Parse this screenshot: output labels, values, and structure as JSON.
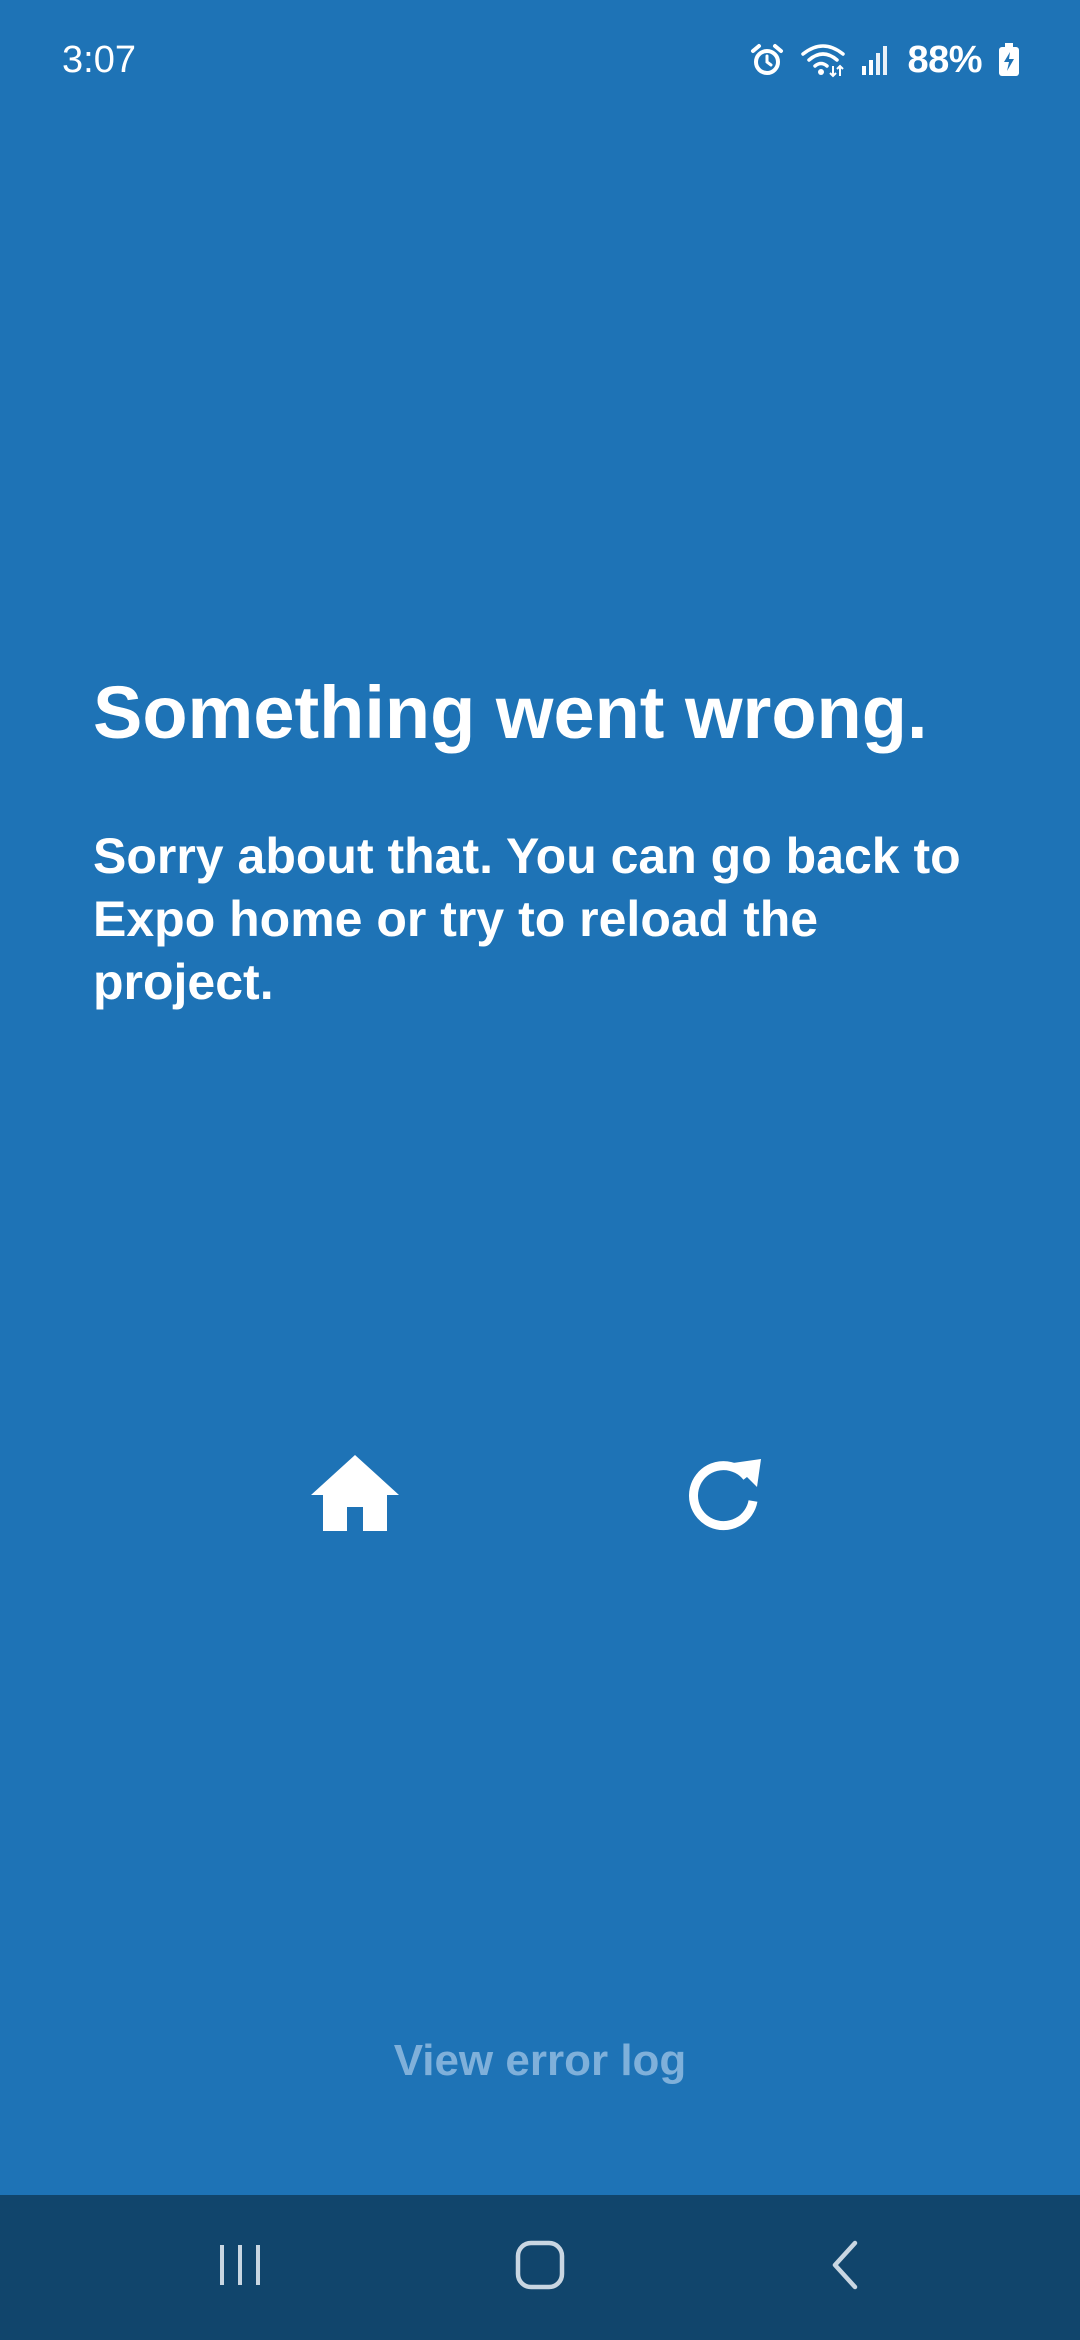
{
  "status_bar": {
    "time": "3:07",
    "battery": "88%",
    "icons": [
      "alarm-icon",
      "wifi-icon",
      "signal-icon",
      "battery-charging-icon"
    ]
  },
  "error": {
    "title": "Something went wrong.",
    "message": "Sorry about that. You can go back to Expo home or try to reload the project."
  },
  "actions": {
    "home_icon": "home-icon",
    "reload_icon": "reload-icon"
  },
  "footer": {
    "view_error_log": "View error log"
  },
  "nav_bar": {
    "buttons": [
      "recent-apps-icon",
      "home-nav-icon",
      "back-icon"
    ]
  },
  "colors": {
    "background": "#1e73b6",
    "nav_background": "#11456c",
    "link_muted": "#7fb0da",
    "text": "#ffffff"
  }
}
